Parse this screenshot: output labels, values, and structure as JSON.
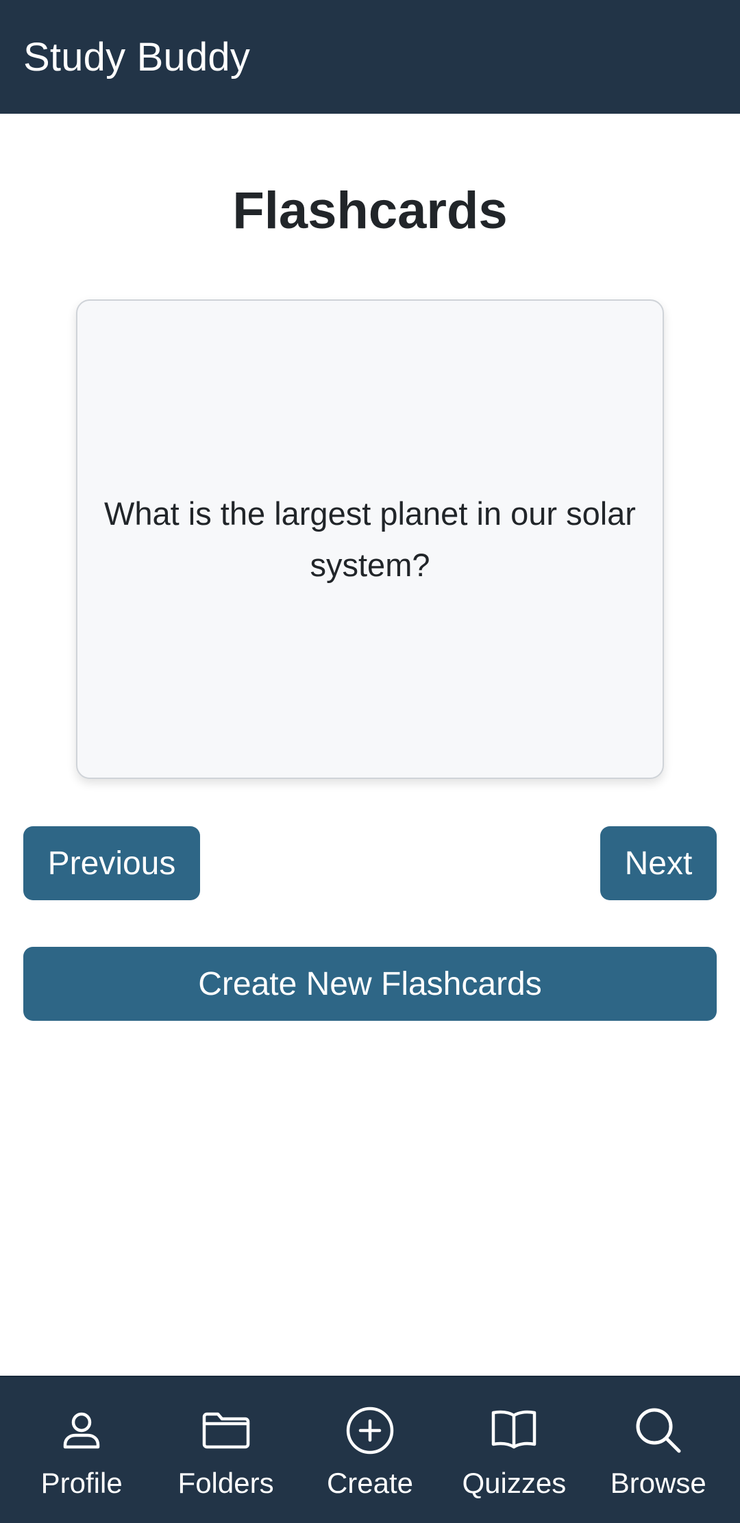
{
  "header": {
    "app_title": "Study Buddy"
  },
  "main": {
    "page_title": "Flashcards",
    "flashcard": {
      "question": "What is the largest planet in our solar system?"
    },
    "buttons": {
      "previous": "Previous",
      "next": "Next",
      "create_new": "Create New Flashcards"
    }
  },
  "bottom_nav": {
    "items": [
      {
        "label": "Profile",
        "icon": "person-icon"
      },
      {
        "label": "Folders",
        "icon": "folder-icon"
      },
      {
        "label": "Create",
        "icon": "plus-circle-icon"
      },
      {
        "label": "Quizzes",
        "icon": "book-icon"
      },
      {
        "label": "Browse",
        "icon": "search-icon"
      }
    ]
  },
  "colors": {
    "header_bg": "#223447",
    "button_bg": "#2e6686",
    "card_bg": "#f7f8fa",
    "text": "#212529"
  }
}
